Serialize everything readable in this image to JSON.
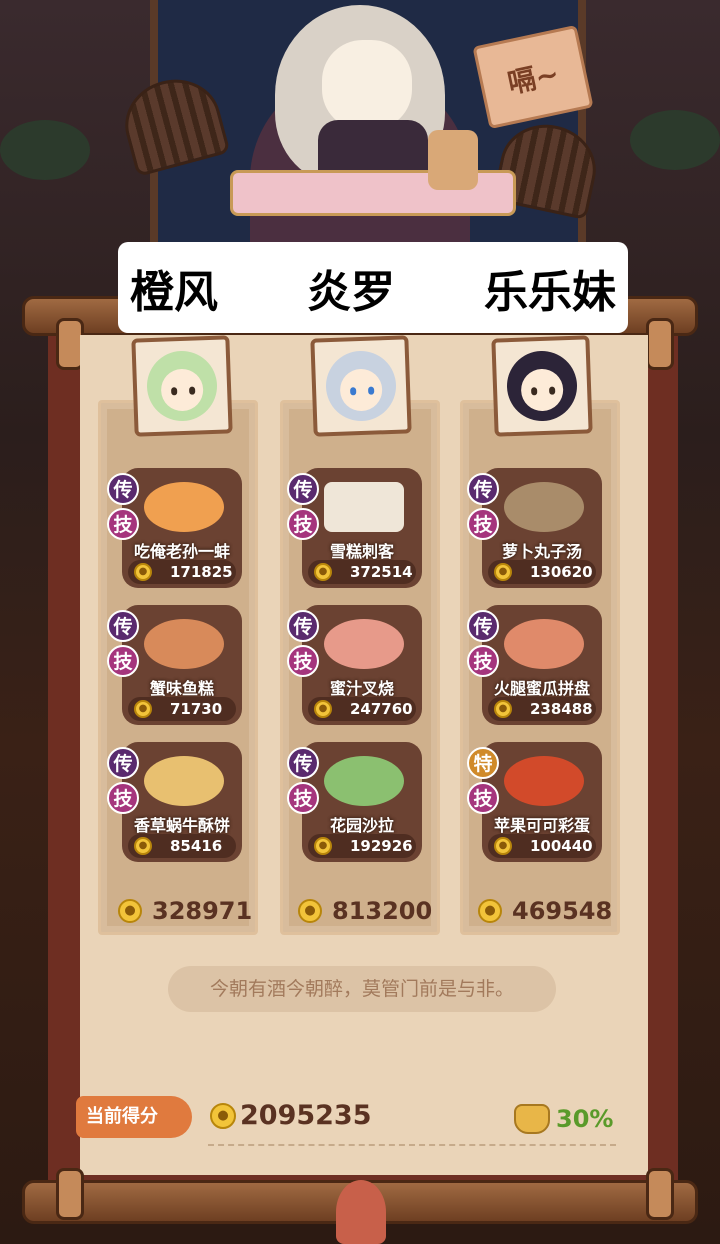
{
  "header": {
    "sign_text": "嗝~"
  },
  "banner": {
    "names": [
      "橙风",
      "炎罗",
      "乐乐妹"
    ]
  },
  "columns": [
    {
      "dishes": [
        {
          "badge_top": "传",
          "badge_bottom": "技",
          "name": "吃俺老孙一蚌",
          "score": "171825"
        },
        {
          "badge_top": "传",
          "badge_bottom": "技",
          "name": "蟹味鱼糕",
          "score": "71730"
        },
        {
          "badge_top": "传",
          "badge_bottom": "技",
          "name": "香草蜗牛酥饼",
          "score": "85416"
        }
      ],
      "total": "328971"
    },
    {
      "dishes": [
        {
          "badge_top": "传",
          "badge_bottom": "技",
          "name": "雪糕刺客",
          "score": "372514"
        },
        {
          "badge_top": "传",
          "badge_bottom": "技",
          "name": "蜜汁叉烧",
          "score": "247760"
        },
        {
          "badge_top": "传",
          "badge_bottom": "技",
          "name": "花园沙拉",
          "score": "192926"
        }
      ],
      "total": "813200"
    },
    {
      "dishes": [
        {
          "badge_top": "传",
          "badge_bottom": "技",
          "name": "萝卜丸子汤",
          "score": "130620"
        },
        {
          "badge_top": "传",
          "badge_bottom": "技",
          "name": "火腿蜜瓜拼盘",
          "score": "238488"
        },
        {
          "badge_top": "特",
          "badge_bottom": "技",
          "name": "苹果可可彩蛋",
          "score": "100440"
        }
      ],
      "total": "469548"
    }
  ],
  "quote": "今朝有酒今朝醉，莫管门前是与非。",
  "footer": {
    "score_label": "当前得分",
    "score_total": "2095235",
    "bonus_percent": "30%"
  }
}
